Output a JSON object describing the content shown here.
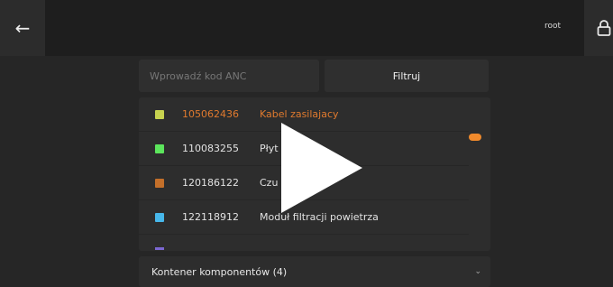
{
  "header": {
    "back_icon": "←",
    "user": "root",
    "lock_icon": "lock-icon"
  },
  "search": {
    "placeholder": "Wprowadź kod ANC",
    "filter_label": "Filtruj"
  },
  "items": [
    {
      "code": "105062436",
      "name": "Kabel zasilajacy",
      "color": "#c7d24f",
      "active": true
    },
    {
      "code": "110083255",
      "name": "Płyt          nki",
      "color": "#5ce55c",
      "active": false
    },
    {
      "code": "120186122",
      "name": "Czu              u",
      "color": "#c36f2a",
      "active": false
    },
    {
      "code": "122118912",
      "name": "Moduł filtracji powietrza",
      "color": "#47b7ea",
      "active": false
    }
  ],
  "container": {
    "label": "Kontener komponentów (4)",
    "chevron": "⌄"
  },
  "colors": {
    "accent": "#f08a2c",
    "partial_item": "#7b67d1"
  },
  "overlay": {
    "icon": "play-icon"
  }
}
